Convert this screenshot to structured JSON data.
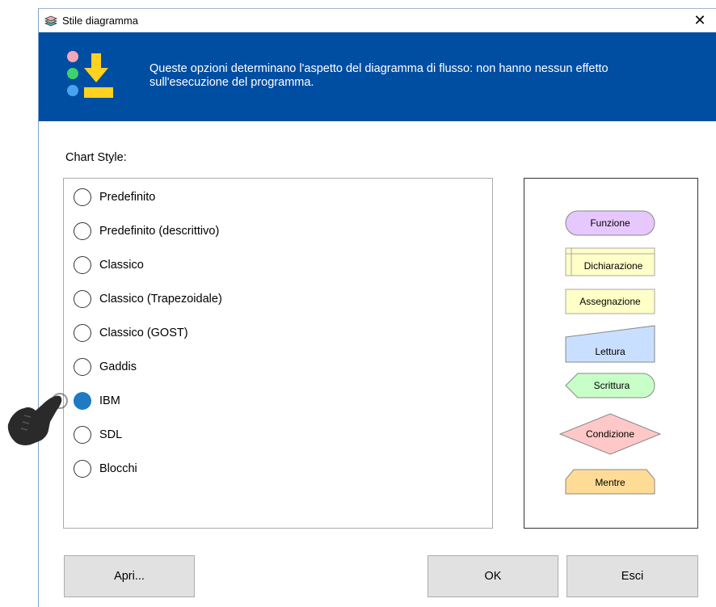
{
  "window": {
    "title": "Stile diagramma",
    "close_glyph": "✕",
    "icon": "flowchart-style-icon"
  },
  "banner": {
    "message": "Queste opzioni determinano l'aspetto del diagramma di flusso: non hanno nessun effetto sull'esecuzione del programma.",
    "background_color": "#004ea2",
    "icon": "shapes-import-icon"
  },
  "chart_style": {
    "label": "Chart Style:",
    "options": [
      {
        "label": "Predefinito",
        "selected": false
      },
      {
        "label": "Predefinito (descrittivo)",
        "selected": false
      },
      {
        "label": "Classico",
        "selected": false
      },
      {
        "label": "Classico (Trapezoidale)",
        "selected": false
      },
      {
        "label": "Classico (GOST)",
        "selected": false
      },
      {
        "label": "Gaddis",
        "selected": false
      },
      {
        "label": "IBM",
        "selected": true
      },
      {
        "label": "SDL",
        "selected": false
      },
      {
        "label": "Blocchi",
        "selected": false
      }
    ]
  },
  "preview": {
    "shapes": [
      {
        "label": "Funzione",
        "fill": "#e6c8ff"
      },
      {
        "label": "Dichiarazione",
        "fill": "#ffffc8"
      },
      {
        "label": "Assegnazione",
        "fill": "#ffffc8"
      },
      {
        "label": "Lettura",
        "fill": "#c8dfff"
      },
      {
        "label": "Scrittura",
        "fill": "#c8ffc8"
      },
      {
        "label": "Condizione",
        "fill": "#ffc8c8"
      },
      {
        "label": "Mentre",
        "fill": "#ffdc96"
      }
    ]
  },
  "buttons": {
    "open": "Apri...",
    "ok": "OK",
    "cancel": "Esci"
  },
  "overlay": {
    "pointer_icon": "pointing-hand-icon"
  }
}
